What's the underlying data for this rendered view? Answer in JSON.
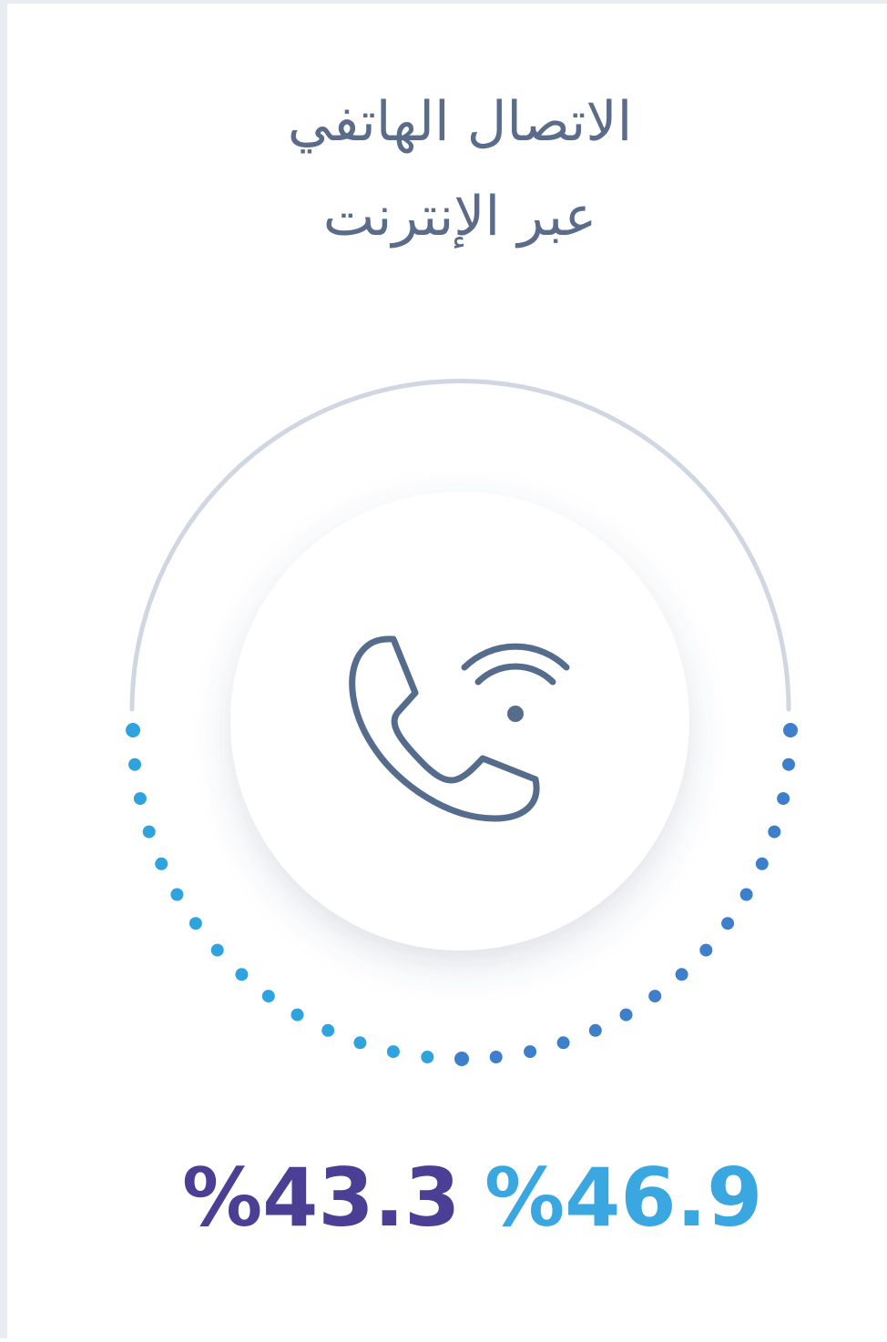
{
  "title": {
    "line1": "الاتصال الهاتفي",
    "line2": "عبر الإنترنت"
  },
  "icons": {
    "center": "phone-wifi-icon"
  },
  "stats": [
    {
      "value": "%43.3",
      "color": "#4a3f95"
    },
    {
      "value": "%46.9",
      "color": "#3aa7e0"
    }
  ],
  "colors": {
    "arc": "#d0d6e2",
    "icon_stroke": "#566c8c",
    "dots_left": "#2ea3de",
    "dots_right": "#3d7fca"
  }
}
